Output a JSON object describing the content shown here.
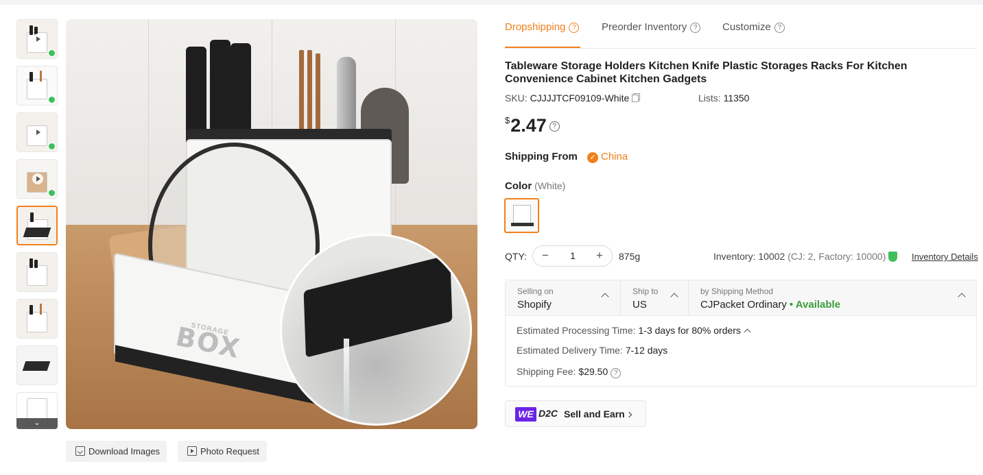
{
  "tabs": [
    {
      "label": "Dropshipping",
      "icon": "question-icon"
    },
    {
      "label": "Preorder Inventory",
      "icon": "question-icon"
    },
    {
      "label": "Customize",
      "icon": "question-icon"
    }
  ],
  "product": {
    "title": "Tableware Storage Holders Kitchen Knife Plastic Storages Racks For Kitchen Convenience Cabinet Kitchen Gadgets",
    "sku_label": "SKU:",
    "sku": "CJJJJTCF09109-White",
    "lists_label": "Lists:",
    "lists": "11350",
    "currency": "$",
    "price": "2.47"
  },
  "shipping_from": {
    "label": "Shipping From",
    "value": "China"
  },
  "color": {
    "label": "Color",
    "selected": "(White)"
  },
  "qty": {
    "label": "QTY:",
    "value": "1",
    "minus": "−",
    "plus": "+",
    "weight": "875g"
  },
  "inventory": {
    "text": "Inventory: 10002",
    "detail": "(CJ: 2, Factory: 10000)",
    "link": "Inventory Details"
  },
  "shipping": {
    "selling_on_label": "Selling on",
    "selling_on": "Shopify",
    "ship_to_label": "Ship to",
    "ship_to": "US",
    "method_label": "by Shipping Method",
    "method": "CJPacket Ordinary",
    "availability": "• Available",
    "processing_label": "Estimated Processing Time:",
    "processing": "1-3 days for 80% orders",
    "delivery_label": "Estimated Delivery Time:",
    "delivery": "7-12 days",
    "fee_label": "Shipping Fee:",
    "fee": "$29.50"
  },
  "sell": {
    "badge": "WE",
    "badge2": "D2C",
    "label": "Sell and Earn"
  },
  "buttons": {
    "download": "Download Images",
    "photo": "Photo Request"
  },
  "gallery": {
    "thumb_count": 9,
    "active_index": 4,
    "box_text": "BOX",
    "box_subtext": "STORAGE"
  },
  "colors": {
    "accent": "#f27f1b",
    "available": "#3a9d3a",
    "we_badge": "#6a24e6"
  }
}
